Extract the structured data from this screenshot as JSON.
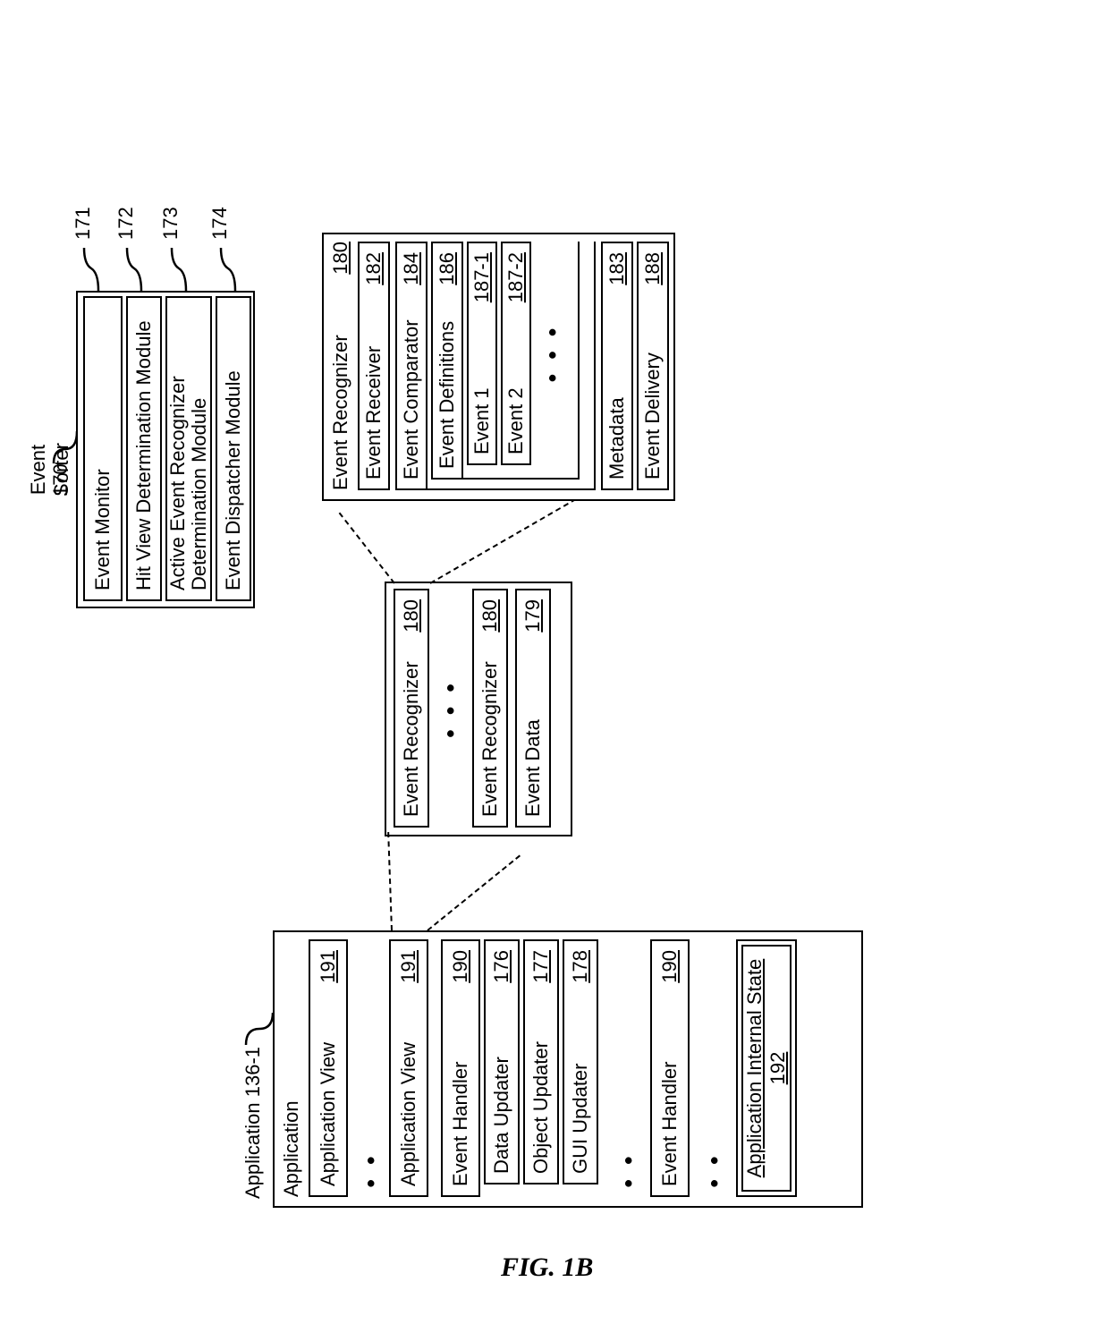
{
  "figure_label": "FIG. 1B",
  "event_sorter": {
    "title": "Event Sorter",
    "ref": "170",
    "rows": [
      {
        "label": "Event Monitor",
        "ref": "171"
      },
      {
        "label": "Hit View Determination Module",
        "ref": "172"
      },
      {
        "label_line1": "Active Event Recognizer",
        "label_line2": "Determination Module",
        "ref": "173"
      },
      {
        "label": "Event Dispatcher Module",
        "ref": "174"
      }
    ]
  },
  "application": {
    "outer_label": "Application 136-1",
    "header": "Application",
    "rows": {
      "app_view_a": {
        "label": "Application View",
        "ref": "191"
      },
      "app_view_b": {
        "label": "Application View",
        "ref": "191"
      },
      "event_handler_a": {
        "label": "Event Handler",
        "ref": "190"
      },
      "data_updater": {
        "label": "Data Updater",
        "ref": "176"
      },
      "object_updater": {
        "label": "Object Updater",
        "ref": "177"
      },
      "gui_updater": {
        "label": "GUI Updater",
        "ref": "178"
      },
      "event_handler_b": {
        "label": "Event Handler",
        "ref": "190"
      },
      "internal_state": {
        "label": "Application Internal State",
        "ref": "192"
      }
    },
    "ellipsis": "• • •"
  },
  "recognizer_stack": {
    "rows": [
      {
        "label": "Event Recognizer",
        "ref": "180"
      },
      {
        "label": "Event Recognizer",
        "ref": "180"
      },
      {
        "label": "Event Data",
        "ref": "179"
      }
    ],
    "ellipsis": "• • •"
  },
  "recognizer_detail": {
    "header": {
      "label": "Event Recognizer",
      "ref": "180"
    },
    "rows": {
      "receiver": {
        "label": "Event Receiver",
        "ref": "182"
      },
      "comparator": {
        "label": "Event Comparator",
        "ref": "184"
      },
      "definitions": {
        "label": "Event Definitions",
        "ref": "186"
      },
      "event1": {
        "label": "Event 1",
        "ref": "187-1"
      },
      "event2": {
        "label": "Event 2",
        "ref": "187-2"
      },
      "metadata": {
        "label": "Metadata",
        "ref": "183"
      },
      "delivery": {
        "label": "Event Delivery",
        "ref": "188"
      }
    },
    "ellipsis": "• • •"
  }
}
